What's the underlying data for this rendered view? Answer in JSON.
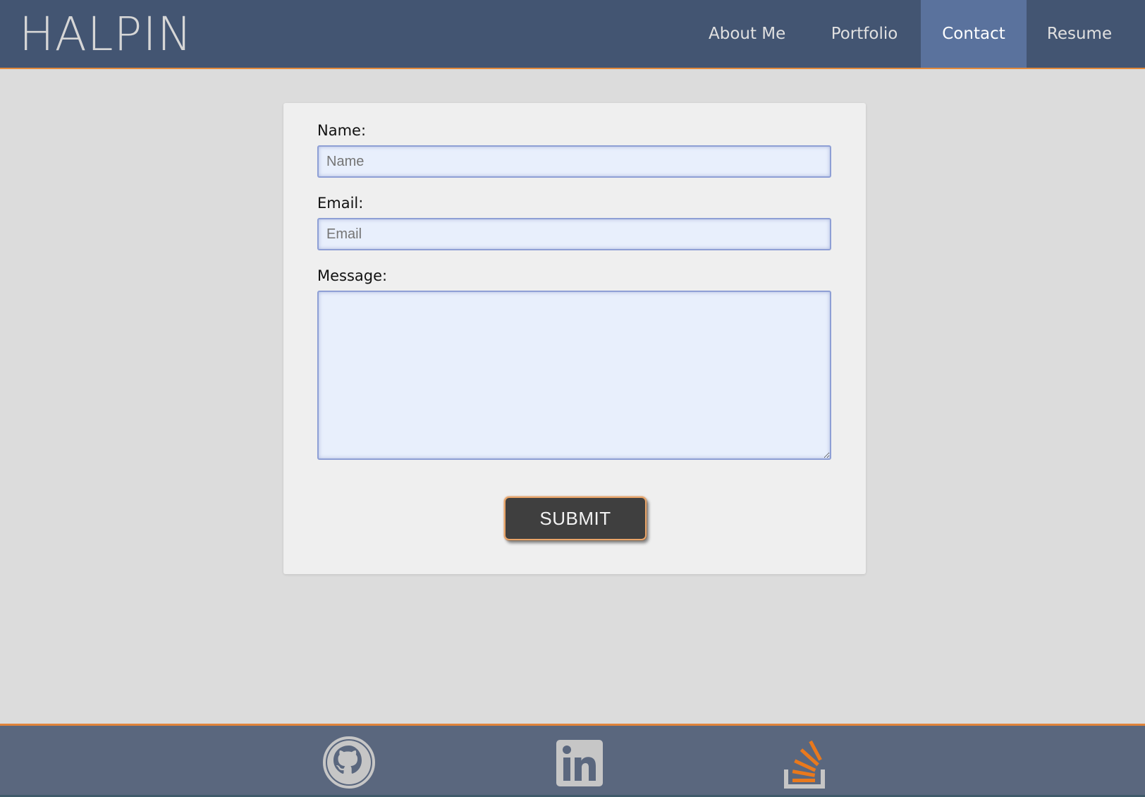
{
  "header": {
    "brand": "HALPIN",
    "nav": [
      {
        "label": "About Me",
        "active": false
      },
      {
        "label": "Portfolio",
        "active": false
      },
      {
        "label": "Contact",
        "active": true
      },
      {
        "label": "Resume",
        "active": false
      }
    ]
  },
  "form": {
    "name_label": "Name:",
    "name_placeholder": "Name",
    "email_label": "Email:",
    "email_placeholder": "Email",
    "message_label": "Message:",
    "submit_label": "SUBMIT"
  },
  "footer": {
    "icons": [
      "github-icon",
      "linkedin-icon",
      "stackoverflow-icon"
    ]
  },
  "colors": {
    "header_bg": "#435572",
    "nav_active_bg": "#5a729d",
    "accent": "#e38a3b",
    "footer_bg": "#5a677e",
    "page_bg": "#dcdcdc",
    "card_bg": "#efefef",
    "input_bg": "#e8effc",
    "button_bg": "#3f3f3f"
  }
}
